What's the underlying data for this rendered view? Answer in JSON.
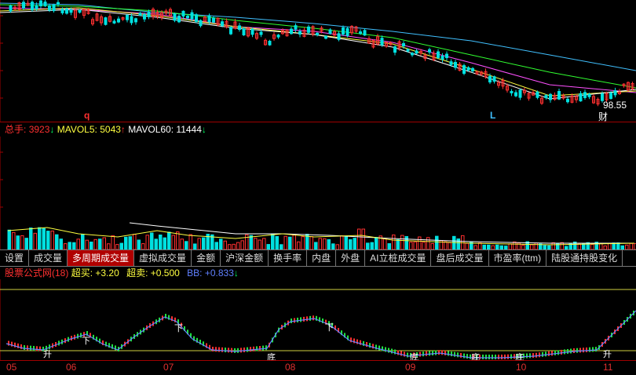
{
  "price_panel": {
    "price_label": "98.55",
    "markers": [
      "q",
      "L",
      "财"
    ]
  },
  "volume_header": {
    "total_label": "总手:",
    "total_value": "3923",
    "mavol5_label": "MAVOL5:",
    "mavol5_value": "5043",
    "mavol60_label": "MAVOL60:",
    "mavol60_value": "11444",
    "arrow_down": "↓",
    "arrow_up": "↑"
  },
  "tabs": [
    {
      "label": "设置",
      "active": false
    },
    {
      "label": "成交量",
      "active": false
    },
    {
      "label": "多周期成交量",
      "active": true
    },
    {
      "label": "虚拟成交量",
      "active": false
    },
    {
      "label": "金额",
      "active": false
    },
    {
      "label": "沪深金额",
      "active": false
    },
    {
      "label": "换手率",
      "active": false
    },
    {
      "label": "内盘",
      "active": false
    },
    {
      "label": "外盘",
      "active": false
    },
    {
      "label": "AI立桩成交量",
      "active": false
    },
    {
      "label": "盘后成交量",
      "active": false
    },
    {
      "label": "市盈率(ttm)",
      "active": false
    },
    {
      "label": "陆股通持股变化",
      "active": false
    }
  ],
  "indicator_header": {
    "name": "股票公式网(18)",
    "overbuy_label": "超买:",
    "overbuy_value": "+3.20",
    "oversell_label": "超卖:",
    "oversell_value": "+0.500",
    "bb_label": "BB:",
    "bb_value": "+0.833",
    "arrow": "↓"
  },
  "indicator_signals": [
    "升",
    "下",
    "下",
    "底",
    "下",
    "底",
    "底",
    "底",
    "升"
  ],
  "x_axis": [
    "05",
    "06",
    "07",
    "08",
    "09",
    "10",
    "11"
  ],
  "colors": {
    "up": "#ff3030",
    "down": "#00e0e0",
    "ma_white": "#ffffff",
    "ma_yellow": "#ffff40",
    "ma_magenta": "#ff50ff",
    "ma_green": "#30ff30",
    "ma_cyan": "#40c0ff",
    "axis_red": "#a00000"
  }
}
